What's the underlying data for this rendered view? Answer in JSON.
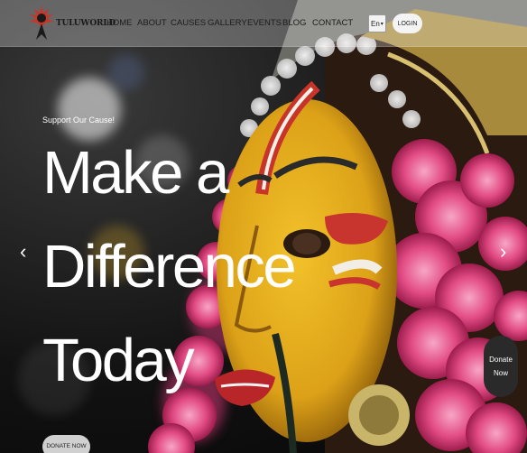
{
  "brand": {
    "name": "TULUWORLD",
    "logo_icon": "tuluworld-logo-icon"
  },
  "nav": {
    "items": [
      {
        "label": "HOME"
      },
      {
        "label": "ABOUT"
      },
      {
        "label": "CAUSES"
      },
      {
        "label": "GALLERY"
      },
      {
        "label": "EVENTS"
      },
      {
        "label": "BLOG"
      },
      {
        "label": "CONTACT"
      }
    ],
    "language": "En",
    "login": "LOGIN"
  },
  "hero": {
    "tagline": "Support Our Cause!",
    "headline": [
      "Make a",
      "Difference",
      "Today"
    ],
    "cta": "DONATE NOW",
    "prev_icon": "chevron-left-icon",
    "next_icon": "chevron-right-icon"
  },
  "donate_float": {
    "line1": "Donate",
    "line2": "Now"
  },
  "colors": {
    "navbar": "#e3e3e3",
    "text": "#ffffff",
    "face": "#e9b41e",
    "flowers": "#e0447c",
    "float_button": "#2a2a2a"
  }
}
